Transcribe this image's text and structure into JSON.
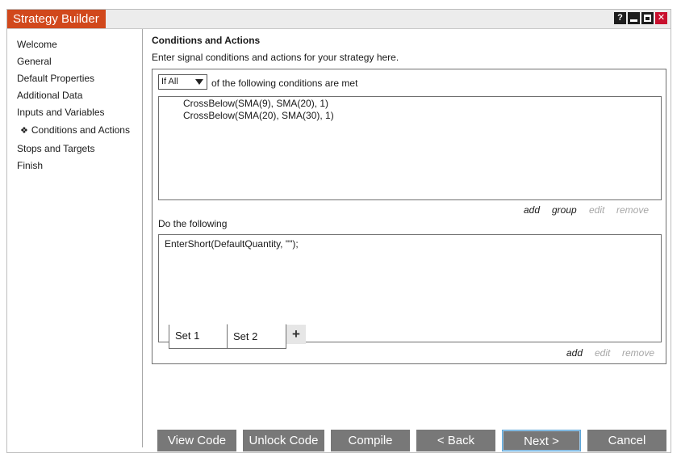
{
  "window": {
    "title": "Strategy Builder",
    "controls": {
      "help": "?",
      "help_icon": "question-icon",
      "minimize_icon": "minimize-icon",
      "maximize_icon": "maximize-icon",
      "close": "✕",
      "close_icon": "close-icon"
    }
  },
  "sidebar": {
    "items": [
      {
        "label": "Welcome"
      },
      {
        "label": "General"
      },
      {
        "label": "Default Properties"
      },
      {
        "label": "Additional Data"
      },
      {
        "label": "Inputs and Variables"
      },
      {
        "label": "Conditions and Actions",
        "selected": true,
        "bullet": "❖"
      },
      {
        "label": "Stops and Targets"
      },
      {
        "label": "Finish"
      }
    ]
  },
  "main": {
    "title": "Conditions and Actions",
    "subtitle": "Enter signal conditions and actions for your strategy here.",
    "condition_mode": {
      "selected": "If All",
      "suffix": "of the following conditions are met"
    },
    "conditions": [
      "CrossBelow(SMA(9), SMA(20), 1)",
      "CrossBelow(SMA(20), SMA(30), 1)"
    ],
    "condition_actions": {
      "add": "add",
      "group": "group",
      "edit": "edit",
      "remove": "remove"
    },
    "do_label": "Do the following",
    "actions": [
      "EnterShort(DefaultQuantity, \"\");"
    ],
    "action_actions": {
      "add": "add",
      "edit": "edit",
      "remove": "remove"
    },
    "sets": [
      {
        "label": "Set 1"
      },
      {
        "label": "Set 2",
        "active": true
      }
    ],
    "add_set": "+"
  },
  "footer": {
    "view_code": "View Code",
    "unlock_code": "Unlock Code",
    "compile": "Compile",
    "back": "< Back",
    "next": "Next >",
    "cancel": "Cancel"
  },
  "colors": {
    "title_tab": "#d1481c",
    "button": "#787878",
    "close_button": "#c8102e",
    "disabled_text": "#a6a6a6"
  }
}
